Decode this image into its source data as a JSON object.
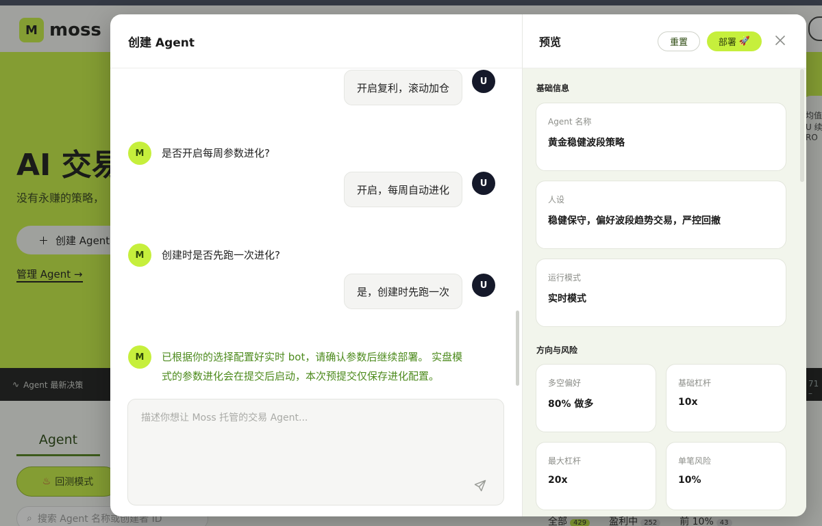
{
  "background": {
    "logo_mark": "M",
    "logo_text": "moss",
    "hero_title": "AI 交易",
    "hero_subtitle": "没有永赚的策略，",
    "create_button": "创建 Agent",
    "manage_link": "管理 Agent →",
    "right_card_text": "均值 TC-U 续适 RO",
    "ticker_label": "Agent 最新决策",
    "ticker_right": "71 –",
    "tab_agent": "Agent",
    "backtest_button": "回测模式",
    "search_placeholder": "搜索 Agent 名称或创建者 ID",
    "filters": [
      {
        "label": "全部",
        "count": "429"
      },
      {
        "label": "盈利中",
        "count": "252"
      },
      {
        "label": "前 10%",
        "count": "43"
      }
    ]
  },
  "modal": {
    "title": "创建 Agent",
    "messages": [
      {
        "role": "user",
        "avatar": "U",
        "text": "开启复利，滚动加仓"
      },
      {
        "role": "bot",
        "avatar": "M",
        "text": "是否开启每周参数进化?"
      },
      {
        "role": "user",
        "avatar": "U",
        "text": "开启，每周自动进化"
      },
      {
        "role": "bot",
        "avatar": "M",
        "text": "创建时是否先跑一次进化?"
      },
      {
        "role": "user",
        "avatar": "U",
        "text": "是，创建时先跑一次"
      },
      {
        "role": "bot",
        "avatar": "M",
        "line1": "已根据你的选择配置好实时 bot，请确认参数后继续部署。 实盘模",
        "line2": "式的参数进化会在提交后启动，本次预提交仅保存进化配置。"
      }
    ],
    "composer_placeholder": "描述你想让 Moss 托管的交易 Agent...",
    "preview": {
      "title": "预览",
      "reset_label": "重置",
      "deploy_label": "部署",
      "deploy_emoji": "🚀",
      "sections": {
        "basic_info": "基础信息",
        "direction_risk": "方向与风险"
      },
      "fields": {
        "agent_name": {
          "label": "Agent 名称",
          "value": "黄金稳健波段策略"
        },
        "persona": {
          "label": "人设",
          "value": "稳健保守，偏好波段趋势交易，严控回撤"
        },
        "run_mode": {
          "label": "运行模式",
          "value": "实时模式"
        },
        "long_short": {
          "label": "多空偏好",
          "value": "80% 做多"
        },
        "base_leverage": {
          "label": "基础杠杆",
          "value": "10x"
        },
        "max_leverage": {
          "label": "最大杠杆",
          "value": "20x"
        },
        "single_risk": {
          "label": "单笔风险",
          "value": "10%"
        }
      }
    }
  },
  "colors": {
    "accent": "#c6ef3c",
    "bot_highlight_text": "#4c8a1c",
    "user_avatar": "#15192a"
  }
}
